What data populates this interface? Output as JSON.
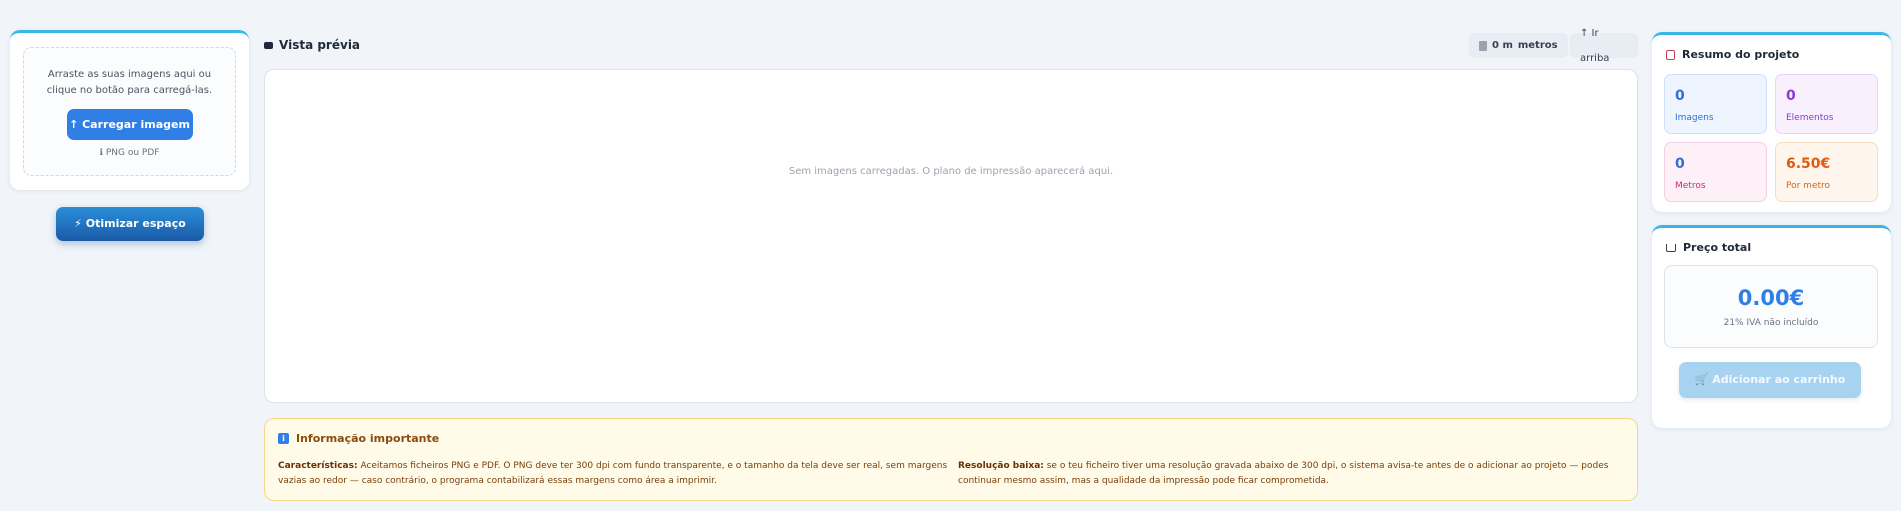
{
  "upload": {
    "instructions": "Arraste as suas imagens aqui ou clique no botão para carregá-las.",
    "button_label": "↑ Carregar imagem",
    "hint": "ℹ PNG ou PDF"
  },
  "optimize": {
    "button_label": "⚡ Otimizar espaço"
  },
  "preview": {
    "title": "Vista prévia",
    "meters_value": "0 m",
    "meters_unit": "metros",
    "scroll_up_label": "↑ Ir arriba",
    "empty_message": "Sem imagens carregadas. O plano de impressão aparecerá aqui."
  },
  "info": {
    "title": "Informação importante",
    "left_label": "Características:",
    "left_text": " Aceitamos ficheiros PNG e PDF. O PNG deve ter 300 dpi com fundo transparente, e o tamanho da tela deve ser real, sem margens vazias ao redor — caso contrário, o programa contabilizará essas margens como área a imprimir.",
    "right_label": "Resolução baixa:",
    "right_text": " se o teu ficheiro tiver uma resolução gravada abaixo de 300 dpi, o sistema avisa-te antes de o adicionar ao projeto — podes continuar mesmo assim, mas a qualidade da impressão pode ficar comprometida."
  },
  "summary": {
    "title": "Resumo do projeto",
    "stats": [
      {
        "value": "0",
        "label": "Imagens"
      },
      {
        "value": "0",
        "label": "Elementos"
      },
      {
        "value": "0",
        "label": "Metros"
      },
      {
        "value": "6.50€",
        "label": "Por metro"
      }
    ]
  },
  "price": {
    "title": "Preço total",
    "total": "0.00€",
    "vat_note": "21% IVA não incluído",
    "cart_button_label": "🛒 Adicionar ao carrinho"
  },
  "colors": {
    "accent": "#2f7fe7",
    "card_top_border": "#38b6e8",
    "info_background": "#fffbe8"
  }
}
